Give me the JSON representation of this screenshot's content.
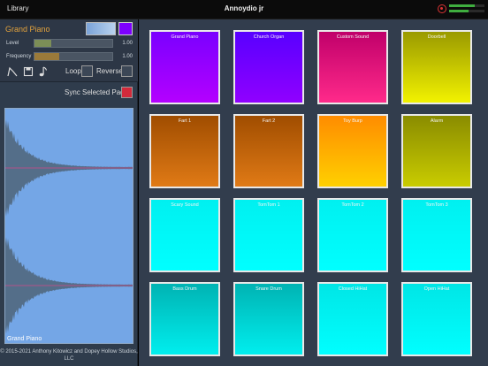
{
  "topbar": {
    "library_label": "Library",
    "app_title": "Annoydio jr"
  },
  "meters": {
    "left_level": 0.72,
    "right_level": 0.55,
    "accent": "#3fae3f"
  },
  "sound_panel": {
    "sound_name": "Grand Piano",
    "color": "#7d00ff",
    "level": {
      "label": "Level",
      "value": "1.00",
      "fill": 0.22
    },
    "frequency": {
      "label": "Frequency",
      "value": "1.00",
      "fill": 0.32
    },
    "icons": [
      "envelope-icon",
      "save-icon",
      "music-note-icon"
    ],
    "loop_label": "Loop",
    "reverse_label": "Reverse",
    "sync_label": "Sync Selected Pad",
    "waveform_name": "Grand Piano"
  },
  "copyright": "© 2015-2021 Anthony Kitowicz and Dopey Hollow Studios, LLC",
  "pads": [
    {
      "label": "Grand Piano",
      "top": "#7a00ff",
      "bottom": "#b400ff"
    },
    {
      "label": "Church Organ",
      "top": "#5800ff",
      "bottom": "#9000ff"
    },
    {
      "label": "Custom Sound",
      "top": "#c0006a",
      "bottom": "#ff2a8a"
    },
    {
      "label": "Doorbell",
      "top": "#9a9a00",
      "bottom": "#f2f200"
    },
    {
      "label": "Fart 1",
      "top": "#a04d00",
      "bottom": "#e07a16"
    },
    {
      "label": "Fart 2",
      "top": "#a04d00",
      "bottom": "#e07a16"
    },
    {
      "label": "Toy Burp",
      "top": "#ff8c00",
      "bottom": "#ffd000"
    },
    {
      "label": "Alarm",
      "top": "#8a8c00",
      "bottom": "#c9cc00"
    },
    {
      "label": "Scary Sound",
      "top": "#00f0f0",
      "bottom": "#00ffff"
    },
    {
      "label": "TomTom 1",
      "top": "#00f0f0",
      "bottom": "#00ffff"
    },
    {
      "label": "TomTom 2",
      "top": "#00f0f0",
      "bottom": "#00ffff"
    },
    {
      "label": "TomTom 3",
      "top": "#00f0f0",
      "bottom": "#00ffff"
    },
    {
      "label": "Bass Drum",
      "top": "#00b3b3",
      "bottom": "#00eeee"
    },
    {
      "label": "Snare Drum",
      "top": "#00b3b3",
      "bottom": "#00eeee"
    },
    {
      "label": "Closed HiHat",
      "top": "#00e6e6",
      "bottom": "#00ffff"
    },
    {
      "label": "Open HiHat",
      "top": "#00e6e6",
      "bottom": "#00ffff"
    }
  ]
}
